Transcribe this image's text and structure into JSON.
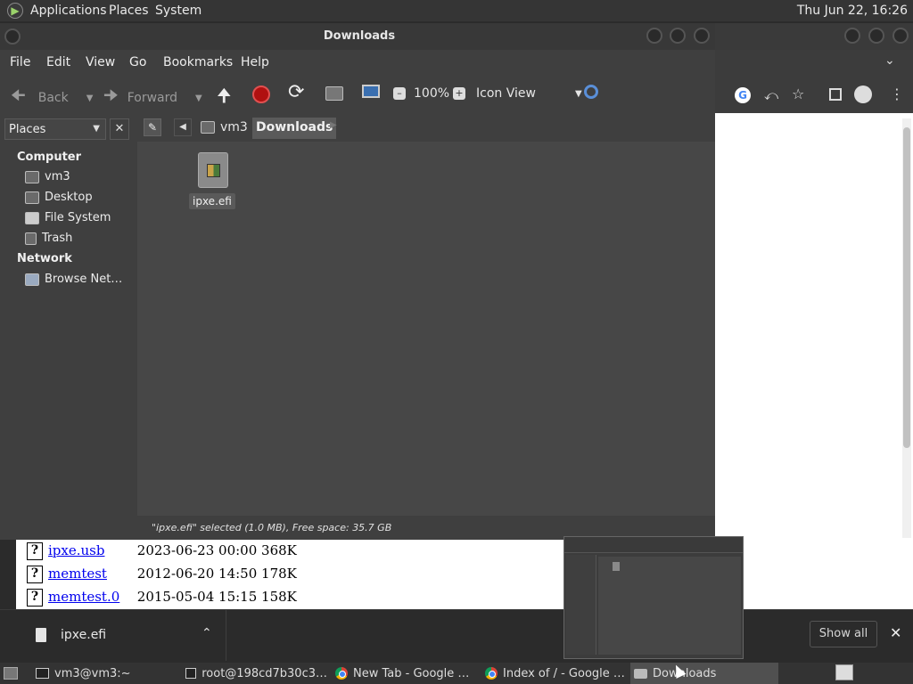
{
  "top_panel": {
    "menus": [
      "Applications",
      "Places",
      "System"
    ],
    "clock": "Thu Jun 22, 16:26"
  },
  "file_manager": {
    "title": "Downloads",
    "menubar": [
      "File",
      "Edit",
      "View",
      "Go",
      "Bookmarks",
      "Help"
    ],
    "toolbar": {
      "back": "Back",
      "forward": "Forward",
      "zoom": "100%",
      "view_mode": "Icon View"
    },
    "sidebar": {
      "selector": "Places",
      "section_computer": "Computer",
      "computer_items": [
        "vm3",
        "Desktop",
        "File System",
        "Trash"
      ],
      "section_network": "Network",
      "network_items": [
        "Browse Net…"
      ]
    },
    "breadcrumb": [
      "vm3",
      "Downloads"
    ],
    "files": [
      {
        "name": "ipxe.efi"
      }
    ],
    "status": "\"ipxe.efi\" selected (1.0 MB), Free space: 35.7 GB"
  },
  "browser_listing": {
    "rows": [
      {
        "name": "ipxe.usb",
        "date": "2023-06-23 00:00",
        "size": "368K"
      },
      {
        "name": "memtest",
        "date": "2012-06-20 14:50",
        "size": "178K"
      },
      {
        "name": "memtest.0",
        "date": "2015-05-04 15:15",
        "size": "158K"
      }
    ]
  },
  "download_bar": {
    "file": "ipxe.efi",
    "show_all": "Show all"
  },
  "taskbar": {
    "tasks": [
      "vm3@vm3:~",
      "root@198cd7b30c3…",
      "New Tab - Google …",
      "Index of / - Google …",
      "Downloads"
    ]
  }
}
